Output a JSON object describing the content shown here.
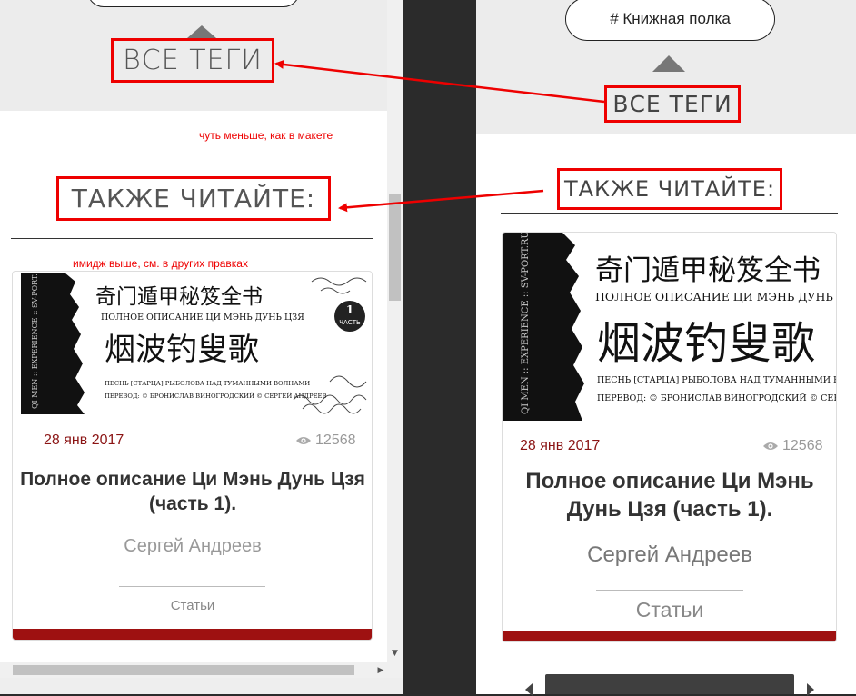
{
  "left_panel": {
    "all_tags_label": "ВСЕ ТЕГИ",
    "note_smaller": "чуть меньше, как в макете",
    "also_read_label": "ТАКЖЕ ЧИТАЙТЕ:",
    "note_image": "имидж выше, см. в других правках",
    "card": {
      "date": "28 янв 2017",
      "views": "12568",
      "title": "Полное описание Ци Мэнь Дунь Цзя (часть 1).",
      "author": "Сергей Андреев",
      "category": "Статьи"
    }
  },
  "right_panel": {
    "tag_pill": "# Книжная полка",
    "all_tags_label": "ВСЕ ТЕГИ",
    "also_read_label": "ТАКЖЕ ЧИТАЙТЕ:",
    "card": {
      "date": "28 янв 2017",
      "views": "12568",
      "title": "Полное описание Ци Мэнь Дунь Цзя (часть 1).",
      "author": "Сергей Андреев",
      "category": "Статьи"
    }
  },
  "book_cover": {
    "cn_title": "奇门遁甲秘笈全书",
    "subtitle": "ПОЛНОЕ ОПИСАНИЕ ЦИ МЭНЬ ДУНЬ ЦЗЯ",
    "cn_big": "烟波钓叟歌",
    "line1": "ПЕСНЬ [СТАРЦА] РЫБОЛОВА НАД ТУМАННЫМИ ВОЛНАМИ",
    "line2": "ПЕРЕВОД: © БРОНИСЛАВ ВИНОГРОДСКИЙ  © СЕРГЕЙ АНДРЕЕВ",
    "side_text": "QI MEN :: EXPERIENCE :: SV-PORT.RU",
    "part_num": "1",
    "part_word": "ЧАСТЬ"
  },
  "colors": {
    "annotation_red": "#ee0000",
    "date_red": "#8b1414",
    "footer_red": "#9e1111",
    "panel_gray": "#ececec",
    "background_dark": "#2b2b2b"
  }
}
